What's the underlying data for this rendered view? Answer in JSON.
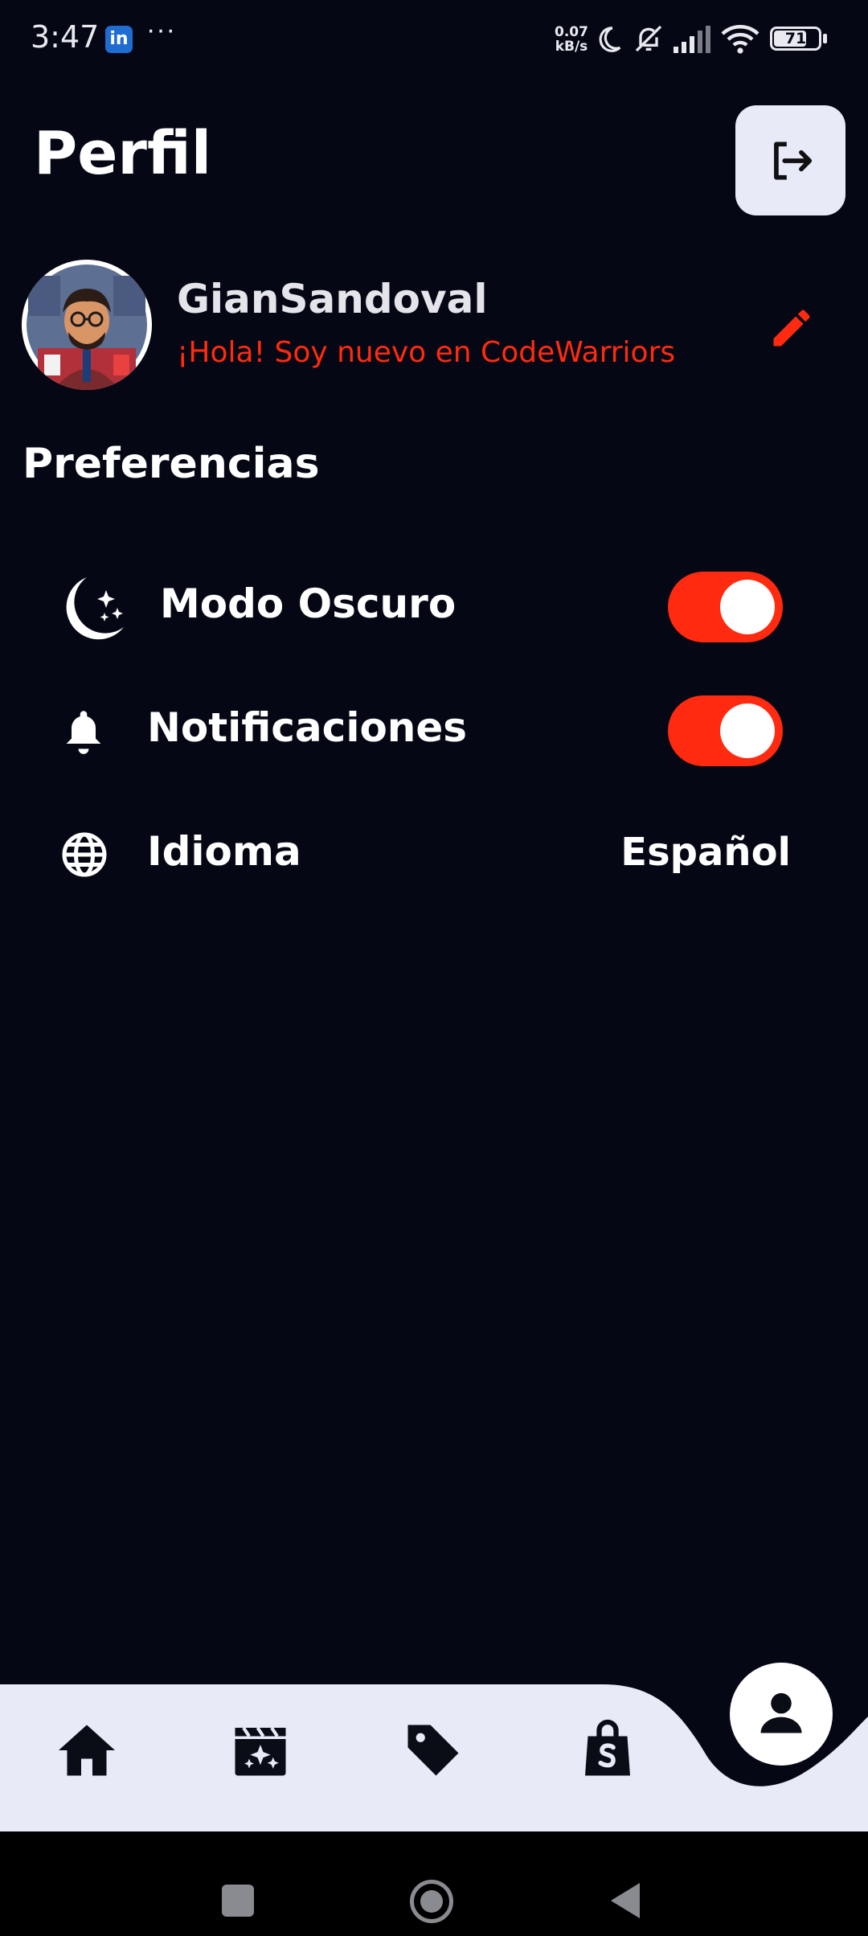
{
  "status_bar": {
    "time": "3:47",
    "linkedin_icon": "in",
    "more_dots": "···",
    "net_speed": "0.07",
    "net_unit": "kB/s",
    "battery": "71"
  },
  "header": {
    "title": "Perfil",
    "logout_icon": "logout-icon"
  },
  "profile": {
    "username": "GianSandoval",
    "bio": "¡Hola! Soy nuevo en CodeWarriors"
  },
  "preferences": {
    "title": "Preferencias",
    "items": [
      {
        "label": "Modo Oscuro",
        "icon": "moon-stars-icon",
        "enabled": true
      },
      {
        "label": "Notificaciones",
        "icon": "bell-icon",
        "enabled": true
      },
      {
        "label": "Idioma",
        "icon": "globe-icon",
        "value": "Español"
      }
    ]
  },
  "bottom_nav": {
    "items": [
      "home-icon",
      "clapperboard-sparkles-icon",
      "tag-icon",
      "shopping-bag-icon",
      "user-icon"
    ],
    "active": "user-icon"
  },
  "colors": {
    "background": "#050814",
    "accent": "#ff2a0f",
    "nav_bg": "#e8eaf8"
  }
}
